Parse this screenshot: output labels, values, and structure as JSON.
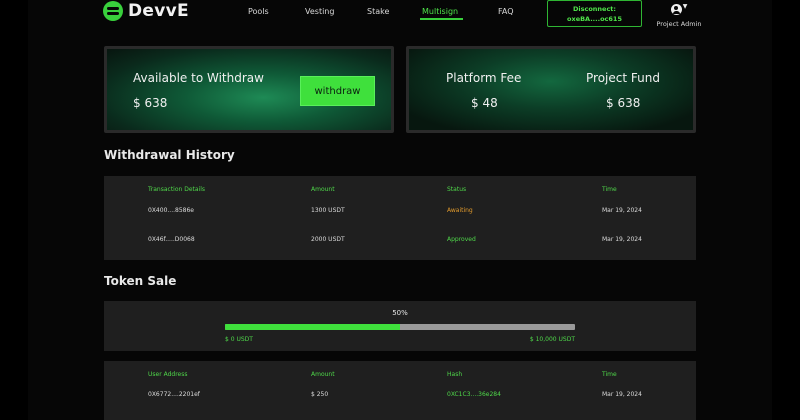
{
  "header": {
    "logo_text": "DevvE",
    "nav": [
      {
        "label": "Pools",
        "active": false
      },
      {
        "label": "Vesting",
        "active": false
      },
      {
        "label": "Stake",
        "active": false
      },
      {
        "label": "Multisign",
        "active": true
      },
      {
        "label": "FAQ",
        "active": false
      }
    ],
    "disconnect_line1": "Disconnect:",
    "disconnect_line2": "oxeBA....oc615",
    "user_icon": "user-icon",
    "admin_label": "Project Admin"
  },
  "cards": {
    "available_title": "Available to Withdraw",
    "available_value": "$ 638",
    "withdraw_label": "withdraw",
    "platform_fee_title": "Platform Fee",
    "platform_fee_value": "$ 48",
    "project_fund_title": "Project Fund",
    "project_fund_value": "$ 638"
  },
  "withdrawal_history": {
    "title": "Withdrawal History",
    "headers": [
      "Transaction Details",
      "Amount",
      "Status",
      "Time"
    ],
    "rows": [
      {
        "tx": "0X400....8586e",
        "amount": "1300 USDT",
        "status": "Awaiting",
        "time": "Mar 19, 2024"
      },
      {
        "tx": "0X46f.....D0068",
        "amount": "2000 USDT",
        "status": "Approved",
        "time": "Mar 19, 2024"
      }
    ]
  },
  "token_sale": {
    "title": "Token Sale",
    "progress_label": "50%",
    "progress_fraction": 0.5,
    "min_label": "$ 0 USDT",
    "max_label": "$ 10,000 USDT",
    "headers": [
      "User Address",
      "Amount",
      "Hash",
      "Time"
    ],
    "rows": [
      {
        "address": "0X6772....2201ef",
        "amount": "$ 250",
        "hash": "0XC1C3....36e284",
        "time": "Mar 19, 2024"
      }
    ]
  },
  "colors": {
    "accent": "#3fe03c",
    "awaiting": "#e19a2c",
    "panel": "#1f1f1f",
    "background": "#060606"
  }
}
